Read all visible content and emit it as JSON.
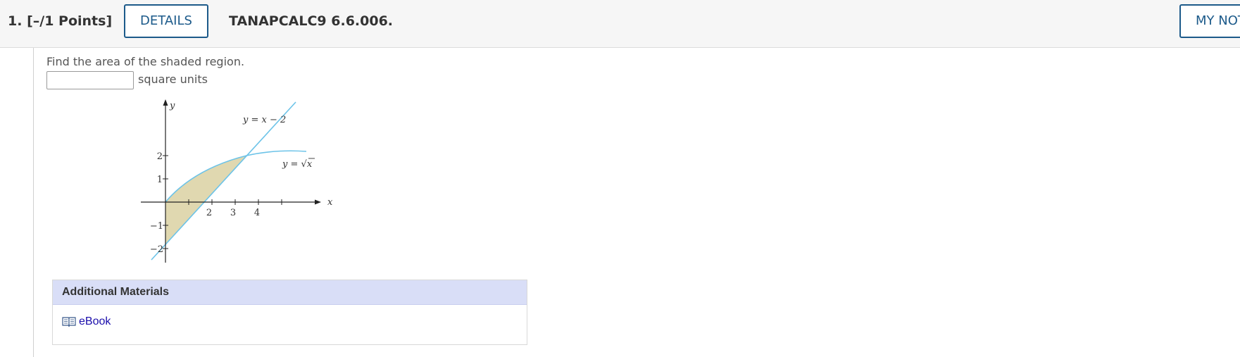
{
  "header": {
    "question_number": "1.",
    "points": "[–/1 Points]",
    "details_label": "DETAILS",
    "question_code": "TANAPCALC9 6.6.006.",
    "my_notes_label": "MY NOTES"
  },
  "question": {
    "prompt": "Find the area of the shaded region.",
    "answer_value": "",
    "units_label": "square units"
  },
  "figure": {
    "y_axis_label": "y",
    "x_axis_label": "x",
    "x_ticks": [
      "2",
      "3",
      "4"
    ],
    "y_ticks": [
      "2",
      "1",
      "−1",
      "−2"
    ],
    "line_label": "y = x − 2",
    "curve_label_prefix": "y = ",
    "curve_label_radicand": "x",
    "shade_color": "#e0d8b0",
    "curve_color": "#6cc3e8"
  },
  "materials": {
    "title": "Additional Materials",
    "ebook_label": "eBook",
    "ebook_icon": "book-icon"
  }
}
